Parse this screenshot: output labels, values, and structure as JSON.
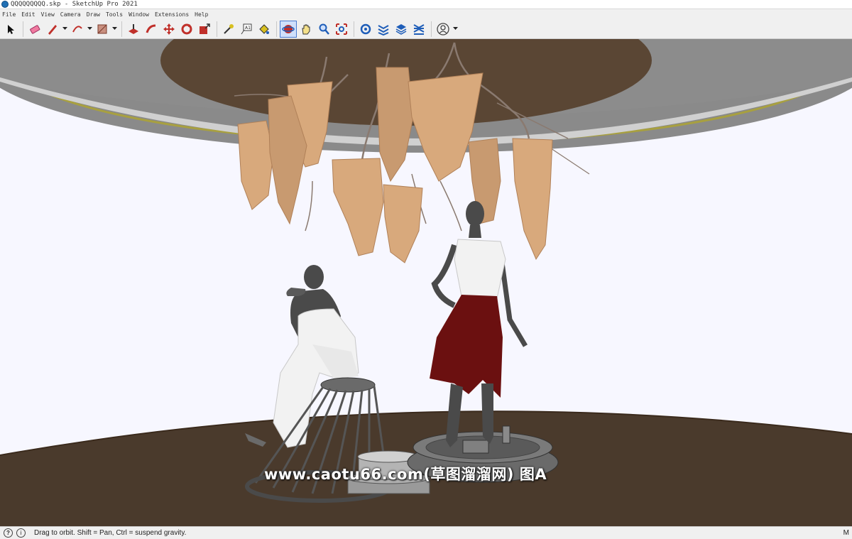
{
  "window": {
    "title": "QQQQQQQQQ.skp - SketchUp Pro 2021"
  },
  "menu": [
    "File",
    "Edit",
    "View",
    "Camera",
    "Draw",
    "Tools",
    "Window",
    "Extensions",
    "Help"
  ],
  "toolbar": {
    "tools": [
      {
        "name": "select-tool-icon",
        "color": "#222222"
      },
      {
        "name": "eraser-tool-icon",
        "color": "#e05080"
      },
      {
        "name": "pencil-line-tool-icon",
        "color": "#c0302a"
      },
      {
        "name": "arc-tool-icon",
        "color": "#c0302a"
      },
      {
        "name": "rectangle-tool-icon",
        "color": "#c0302a"
      },
      {
        "name": "push-pull-tool-icon",
        "color": "#c0302a"
      },
      {
        "name": "follow-me-tool-icon",
        "color": "#c0302a"
      },
      {
        "name": "move-tool-icon",
        "color": "#c0302a"
      },
      {
        "name": "rotate-tool-icon",
        "color": "#c0302a"
      },
      {
        "name": "scale-tool-icon",
        "color": "#c0302a"
      },
      {
        "name": "tape-measure-tool-icon",
        "color": "#c8b020"
      },
      {
        "name": "text-tool-icon",
        "color": "#444444"
      },
      {
        "name": "paint-bucket-tool-icon",
        "color": "#c8b020"
      },
      {
        "name": "orbit-tool-icon",
        "color": "#c0302a"
      },
      {
        "name": "pan-tool-icon",
        "color": "#c8b020"
      },
      {
        "name": "zoom-tool-icon",
        "color": "#1e5db8"
      },
      {
        "name": "zoom-extents-tool-icon",
        "color": "#1e5db8"
      },
      {
        "name": "3d-warehouse-icon",
        "color": "#1e5db8"
      },
      {
        "name": "extension-warehouse-icon",
        "color": "#1e5db8"
      },
      {
        "name": "layout-send-icon",
        "color": "#1e5db8"
      },
      {
        "name": "extension-manager-icon",
        "color": "#1e5db8"
      },
      {
        "name": "account-icon",
        "color": "#444444"
      }
    ]
  },
  "watermark": "www.caotu66.com(草图溜溜网) 图A",
  "status": {
    "message": "Drag to orbit. Shift = Pan, Ctrl = suspend gravity.",
    "right_label": "M"
  },
  "scene": {
    "floor_color": "#4a3a2c",
    "ceiling_color": "#5a4634",
    "ceiling_rim_color": "#8a8a8a",
    "background_color": "#f7f7ff",
    "foliage_color": "#d8a97c",
    "skirt_color": "#6b1010",
    "blouse_color": "#f2f2f2",
    "mannequin_color": "#4a4a4a"
  }
}
